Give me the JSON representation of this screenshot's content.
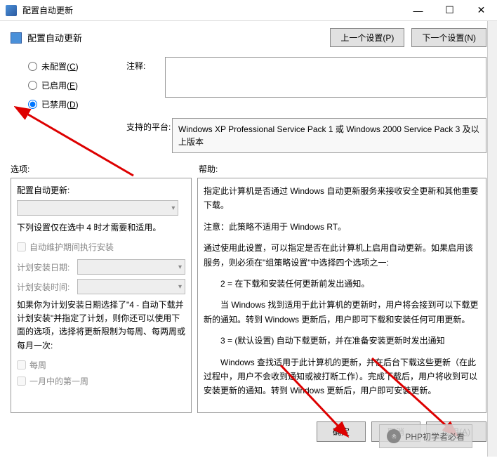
{
  "window": {
    "title": "配置自动更新",
    "minimize": "—",
    "maximize": "☐",
    "close": "✕"
  },
  "subheader": {
    "title": "配置自动更新",
    "prev": "上一个设置(P)",
    "next": "下一个设置(N)"
  },
  "radios": {
    "not_configured": "未配置(C)",
    "enabled": "已启用(E)",
    "disabled": "已禁用(D)"
  },
  "labels": {
    "comment": "注释:",
    "platform": "支持的平台:",
    "options": "选项:",
    "help": "帮助:"
  },
  "platform_text": "Windows XP Professional Service Pack 1 或 Windows 2000 Service Pack 3 及以上版本",
  "options_panel": {
    "title": "配置自动更新:",
    "note": "下列设置仅在选中 4 时才需要和适用。",
    "check_maintenance": "自动维护期间执行安装",
    "install_day_label": "计划安装日期:",
    "install_time_label": "计划安装时间:",
    "para": "如果你为计划安装日期选择了\"4 - 自动下载并计划安装\"并指定了计划，则你还可以使用下面的选项，选择将更新限制为每周、每两周或每月一次:",
    "check_weekly": "每周",
    "check_first_week": "一月中的第一周"
  },
  "help_panel": {
    "p1": "指定此计算机是否通过 Windows 自动更新服务来接收安全更新和其他重要下载。",
    "p2": "注意：此策略不适用于 Windows RT。",
    "p3": "通过使用此设置，可以指定是否在此计算机上启用自动更新。如果启用该服务，则必须在\"组策略设置\"中选择四个选项之一:",
    "p4": "2 = 在下载和安装任何更新前发出通知。",
    "p5": "当 Windows 找到适用于此计算机的更新时，用户将会接到可以下载更新的通知。转到 Windows 更新后，用户即可下载和安装任何可用更新。",
    "p6": "3 = (默认设置) 自动下载更新，并在准备安装更新时发出通知",
    "p7": "Windows 查找适用于此计算机的更新，并在后台下载这些更新（在此过程中，用户不会收到通知或被打断工作）。完成下载后，用户将收到可以安装更新的通知。转到 Windows 更新后，用户即可安装更新。"
  },
  "buttons": {
    "ok": "确定",
    "cancel": "取消",
    "apply": "应用(A)"
  },
  "watermark": "PHP初学者必看"
}
